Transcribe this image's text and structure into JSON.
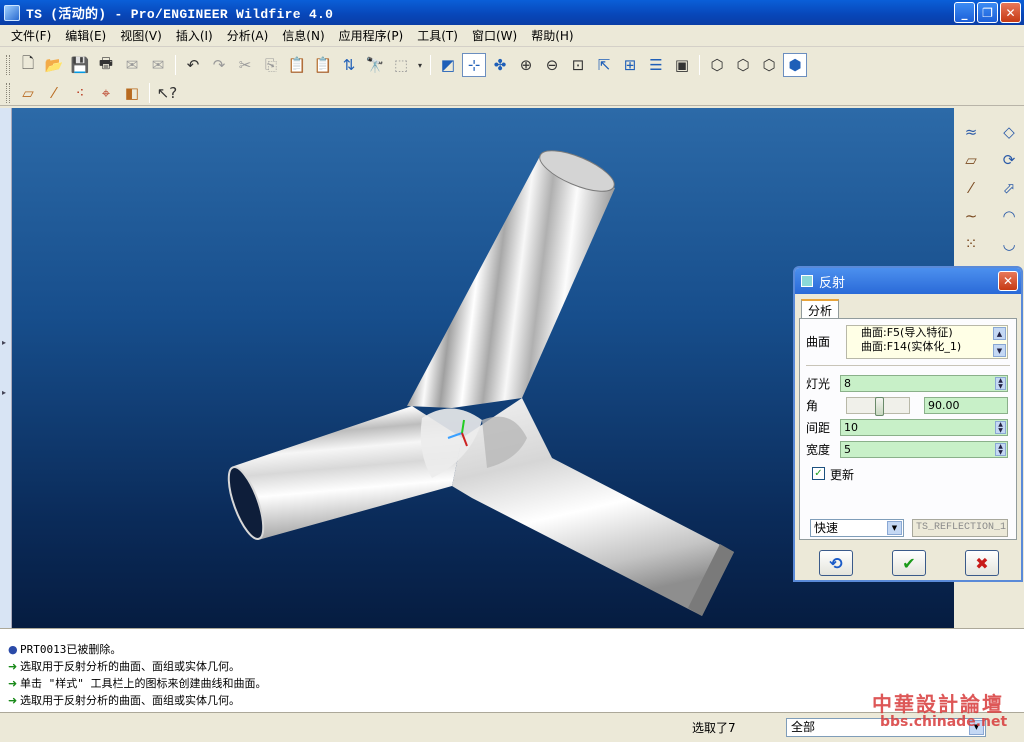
{
  "window": {
    "title": "TS (活动的) - Pro/ENGINEER Wildfire 4.0",
    "minimize": "_",
    "maximize": "❐",
    "close": "✕"
  },
  "menu": [
    "文件(F)",
    "编辑(E)",
    "视图(V)",
    "插入(I)",
    "分析(A)",
    "信息(N)",
    "应用程序(P)",
    "工具(T)",
    "窗口(W)",
    "帮助(H)"
  ],
  "dialog": {
    "title": "反射",
    "tab": "分析",
    "surface_label": "曲面",
    "surfaces": [
      "曲面:F5(导入特征)",
      "曲面:F14(实体化_1)"
    ],
    "light_label": "灯光",
    "light_value": "8",
    "angle_label": "角",
    "angle_value": "90.00",
    "spacing_label": "间距",
    "spacing_value": "10",
    "width_label": "宽度",
    "width_value": "5",
    "update_label": "更新",
    "update_checked": true,
    "mode_value": "快速",
    "result_name": "TS_REFLECTION_1"
  },
  "messages": [
    {
      "marker": "dot",
      "text": "PRT0013已被删除。"
    },
    {
      "marker": "arrow",
      "text": "选取用于反射分析的曲面、面组或实体几何。"
    },
    {
      "marker": "arrow",
      "text": "单击 \"样式\" 工具栏上的图标来创建曲线和曲面。"
    },
    {
      "marker": "arrow",
      "text": "选取用于反射分析的曲面、面组或实体几何。"
    }
  ],
  "status": {
    "selected": "选取了7",
    "filter_value": "全部"
  },
  "watermark": {
    "name": "中華設計論壇",
    "url": "bbs.chinade.net"
  },
  "colors": {
    "viewport_top": "#2c6aa8",
    "viewport_bottom": "#061c40",
    "title_blue": "#0a5fd8",
    "field_green": "#c8f0c8"
  }
}
